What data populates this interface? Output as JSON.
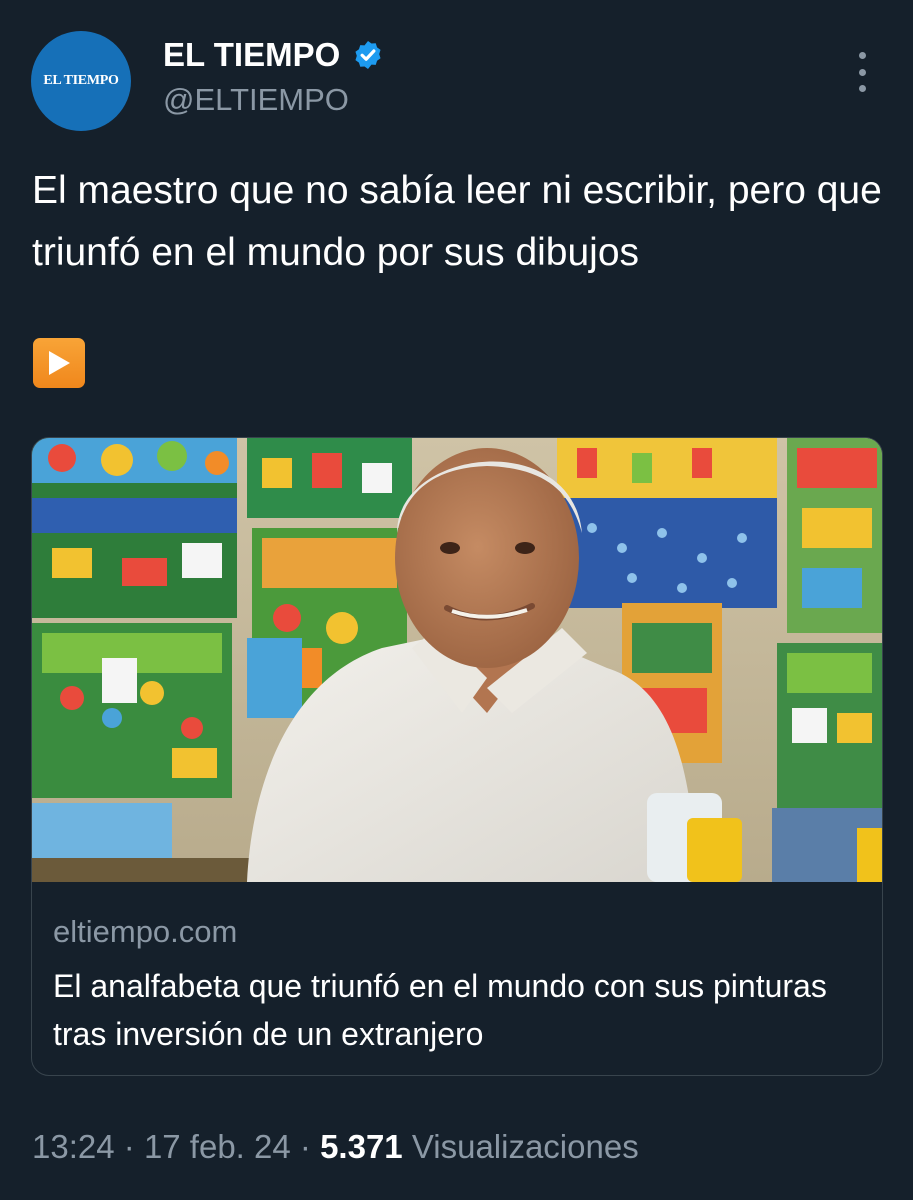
{
  "author": {
    "avatar_text": "EL TIEMPO",
    "display_name": "EL TIEMPO",
    "handle": "@ELTIEMPO",
    "verified": true,
    "avatar_color": "#1670b8",
    "verified_color": "#1d9bf0"
  },
  "tweet": {
    "text": "El maestro que no sabía leer ni escribir, pero que triunfó en el mundo por sus dibujos",
    "emoji": "play-button-emoji"
  },
  "card": {
    "image_description_icon": "photo",
    "domain": "eltiempo.com",
    "title": "El analfabeta que triunfó en el mundo con sus pinturas tras inversión de un extranjero"
  },
  "footer": {
    "time": "13:24",
    "separator": "·",
    "date": "17 feb. 24",
    "views_count": "5.371",
    "views_label": "Visualizaciones"
  },
  "colors": {
    "background": "#15202b",
    "secondary_text": "#8b98a5",
    "border": "#38444d"
  }
}
